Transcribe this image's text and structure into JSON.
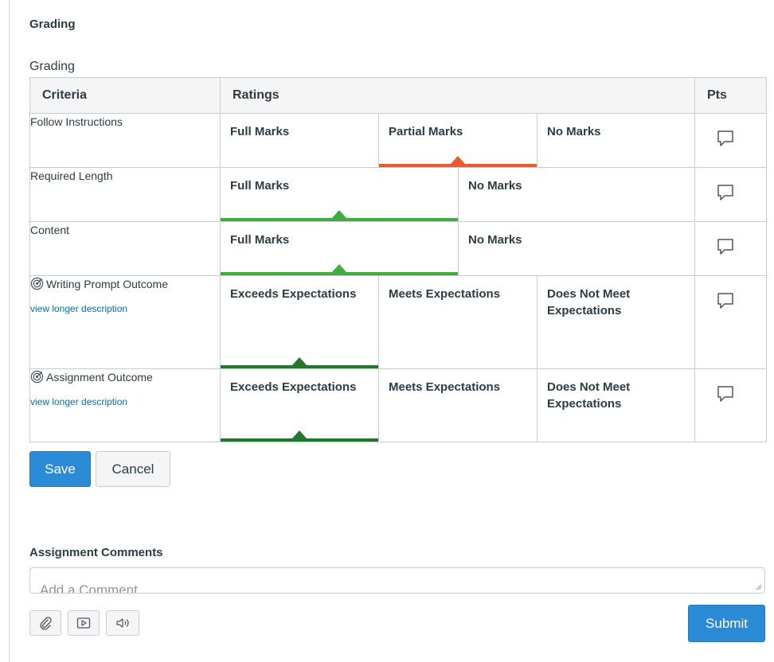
{
  "section_title": "Grading",
  "rubric": {
    "caption": "Grading",
    "headers": {
      "criteria": "Criteria",
      "ratings": "Ratings",
      "pts": "Pts"
    },
    "rows": [
      {
        "criterion": "Follow Instructions",
        "ratings": [
          "Full Marks",
          "Partial Marks",
          "No Marks"
        ],
        "selected": "Partial Marks"
      },
      {
        "criterion": "Required Length",
        "ratings": [
          "Full Marks",
          "No Marks"
        ],
        "selected": "Full Marks"
      },
      {
        "criterion": "Content",
        "ratings": [
          "Full Marks",
          "No Marks"
        ],
        "selected": "Full Marks"
      },
      {
        "criterion": "Writing Prompt Outcome",
        "link": "view longer description",
        "ratings": [
          "Exceeds Expectations",
          "Meets Expectations",
          "Does Not Meet Expectations"
        ],
        "selected": "Exceeds Expectations"
      },
      {
        "criterion": "Assignment Outcome",
        "link": "view longer description",
        "ratings": [
          "Exceeds Expectations",
          "Meets Expectations",
          "Does Not Meet Expectations"
        ],
        "selected": "Exceeds Expectations"
      }
    ]
  },
  "buttons": {
    "save": "Save",
    "cancel": "Cancel",
    "submit": "Submit"
  },
  "comments": {
    "heading": "Assignment Comments",
    "placeholder": "Add a Comment"
  },
  "icons": [
    "comment-icon",
    "outcome-target-icon",
    "paperclip-icon",
    "media-icon",
    "audio-icon"
  ],
  "colors": {
    "partial": "#ea5a2d",
    "full": "#3ead3e",
    "outcome": "#22772f",
    "primary": "#2b8bd6",
    "link": "#0770a3"
  }
}
